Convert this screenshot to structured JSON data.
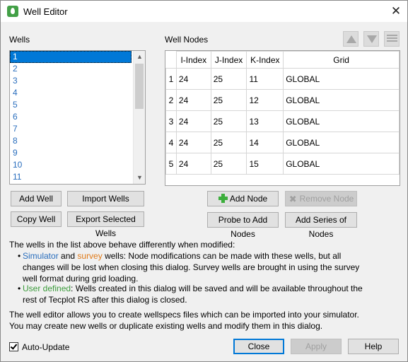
{
  "window": {
    "title": "Well Editor"
  },
  "wells": {
    "label": "Wells",
    "items": [
      "1",
      "2",
      "3",
      "4",
      "5",
      "6",
      "7",
      "8",
      "9",
      "10",
      "11"
    ],
    "selected_index": 0
  },
  "well_nodes": {
    "label": "Well Nodes",
    "columns": [
      "I-Index",
      "J-Index",
      "K-Index",
      "Grid"
    ],
    "rows": [
      {
        "num": "1",
        "i": "24",
        "j": "25",
        "k": "11",
        "grid": "GLOBAL"
      },
      {
        "num": "2",
        "i": "24",
        "j": "25",
        "k": "12",
        "grid": "GLOBAL"
      },
      {
        "num": "3",
        "i": "24",
        "j": "25",
        "k": "13",
        "grid": "GLOBAL"
      },
      {
        "num": "4",
        "i": "24",
        "j": "25",
        "k": "14",
        "grid": "GLOBAL"
      },
      {
        "num": "5",
        "i": "24",
        "j": "25",
        "k": "15",
        "grid": "GLOBAL"
      }
    ]
  },
  "buttons": {
    "add_well": "Add Well",
    "import_wells": "Import Wells",
    "copy_well": "Copy Well",
    "export_selected_wells": "Export Selected Wells",
    "add_node": "Add Node",
    "remove_node": "Remove Node",
    "probe_to_add_nodes": "Probe to Add Nodes",
    "add_series_of_nodes": "Add Series of Nodes",
    "close": "Close",
    "apply": "Apply",
    "help": "Help"
  },
  "info": {
    "intro": "The wells in the list above behave differently when modified:",
    "bullet1_simulator": "Simulator",
    "bullet1_and": " and ",
    "bullet1_survey": "survey",
    "bullet1_rest": " wells: Node modifications can be made with these wells, but all changes will be lost when closing this dialog. Survey wells are brought in using the survey well format during grid loading.",
    "bullet2_user_defined": "User defined",
    "bullet2_rest": ": Wells created in this dialog will be saved and will be available throughout the rest of Tecplot RS after this dialog is closed.",
    "footer": "The well editor allows you to create wellspecs files which can be imported into your simulator. You may create new wells or duplicate existing wells and modify them in this dialog."
  },
  "auto_update": {
    "label": "Auto-Update",
    "checked": true
  },
  "icons": {
    "app": "well-editor-app-icon",
    "close": "close-icon",
    "move_up": "move-up-icon",
    "move_down": "move-down-icon",
    "list": "list-icon",
    "add": "plus-icon",
    "remove": "x-icon"
  },
  "colors": {
    "selection": "#0078d7",
    "link_blue": "#2a6ebd",
    "survey_orange": "#e07b1a",
    "user_defined_green": "#3a9a3a",
    "app_icon_green": "#43a047"
  }
}
